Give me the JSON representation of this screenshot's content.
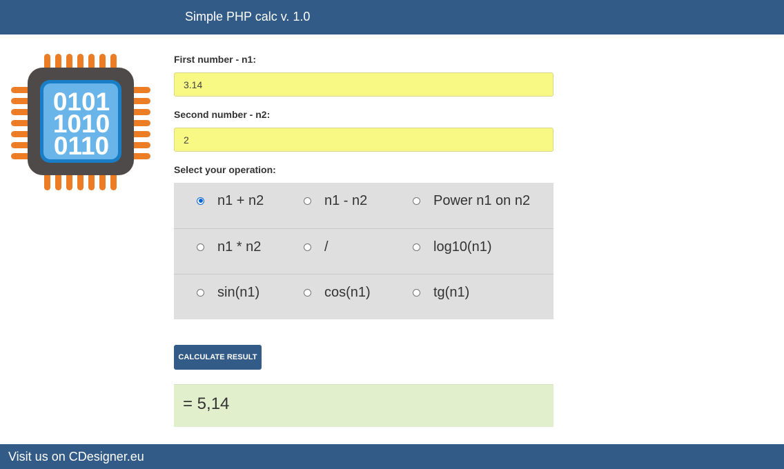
{
  "header": {
    "title": "Simple PHP calc v. 1.0"
  },
  "logo": {
    "icon": "cpu-chip-icon",
    "lines": [
      "0101",
      "1010",
      "0110"
    ]
  },
  "form": {
    "n1": {
      "label": "First number - n1:",
      "value": "3.14"
    },
    "n2": {
      "label": "Second number - n2:",
      "value": "2"
    },
    "operation_label": "Select your operation:",
    "operations": [
      {
        "label": "n1 + n2",
        "checked": true
      },
      {
        "label": "n1 - n2",
        "checked": false
      },
      {
        "label": "Power n1 on n2",
        "checked": false
      },
      {
        "label": "n1 * n2",
        "checked": false
      },
      {
        "label": "/",
        "checked": false
      },
      {
        "label": "log10(n1)",
        "checked": false
      },
      {
        "label": "sin(n1)",
        "checked": false
      },
      {
        "label": "cos(n1)",
        "checked": false
      },
      {
        "label": "tg(n1)",
        "checked": false
      }
    ],
    "calculate_label": "CALCULATE RESULT",
    "result": "= 5,14"
  },
  "footer": {
    "text": "Visit us on CDesigner.eu"
  },
  "colors": {
    "header": "#325c87",
    "input_bg": "#f8f984",
    "ops_bg": "#dfdfdf",
    "result_bg": "#e1efcd",
    "chip_orange": "#ec7d24",
    "chip_blue": "#4ea7e2"
  }
}
